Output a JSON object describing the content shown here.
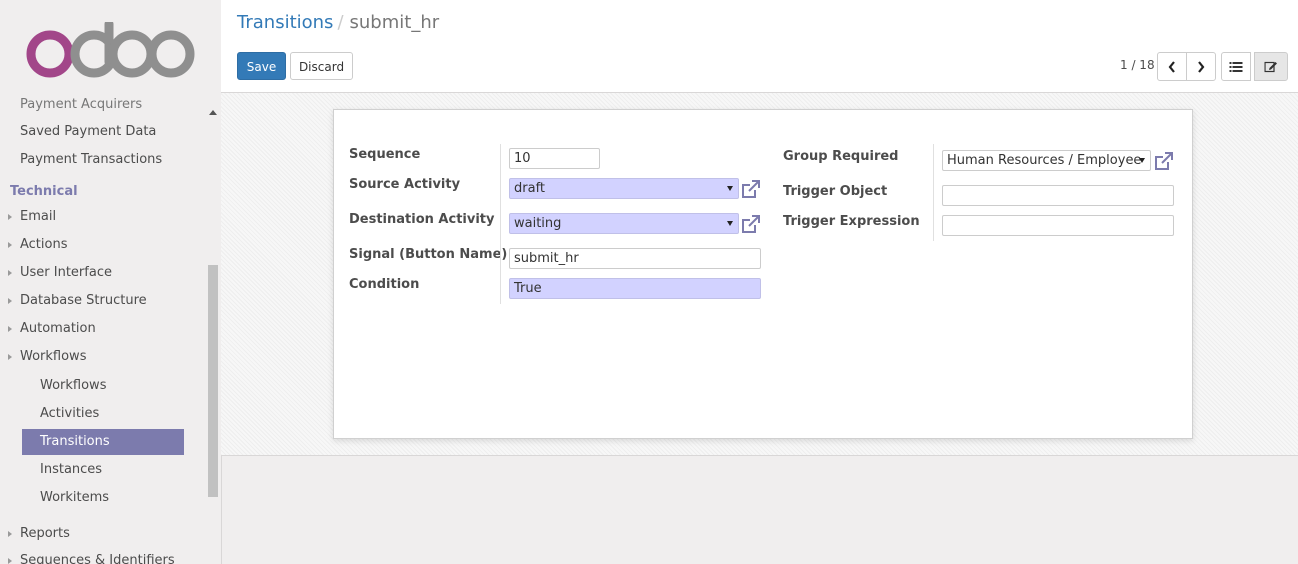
{
  "sidebar": {
    "partial_top_item": "Payment Acquirers",
    "items_top": [
      "Saved Payment Data",
      "Payment Transactions"
    ],
    "section": "Technical",
    "groups": [
      "Email",
      "Actions",
      "User Interface",
      "Database Structure",
      "Automation",
      "Workflows"
    ],
    "workflow_children": [
      "Workflows",
      "Activities",
      "Transitions",
      "Instances",
      "Workitems"
    ],
    "active_item": "Transitions",
    "groups_bottom": [
      "Reports",
      "Sequences & Identifiers"
    ]
  },
  "breadcrumb": {
    "parent": "Transitions",
    "separator": "/",
    "current": "submit_hr"
  },
  "buttons": {
    "save": "Save",
    "discard": "Discard"
  },
  "pager": {
    "text": "1 / 18"
  },
  "form": {
    "sequence": {
      "label": "Sequence",
      "value": "10"
    },
    "source_activity": {
      "label": "Source Activity",
      "value": "draft"
    },
    "destination_activity": {
      "label": "Destination Activity",
      "value": "waiting"
    },
    "signal": {
      "label": "Signal (Button Name)",
      "value": "submit_hr"
    },
    "condition": {
      "label": "Condition",
      "value": "True"
    },
    "group_required": {
      "label": "Group Required",
      "value": "Human Resources / Employee"
    },
    "trigger_object": {
      "label": "Trigger Object",
      "value": ""
    },
    "trigger_expression": {
      "label": "Trigger Expression",
      "value": ""
    }
  },
  "colors": {
    "accent": "#7c7bad",
    "primary": "#337ab7",
    "required_bg": "#d2d2ff"
  }
}
